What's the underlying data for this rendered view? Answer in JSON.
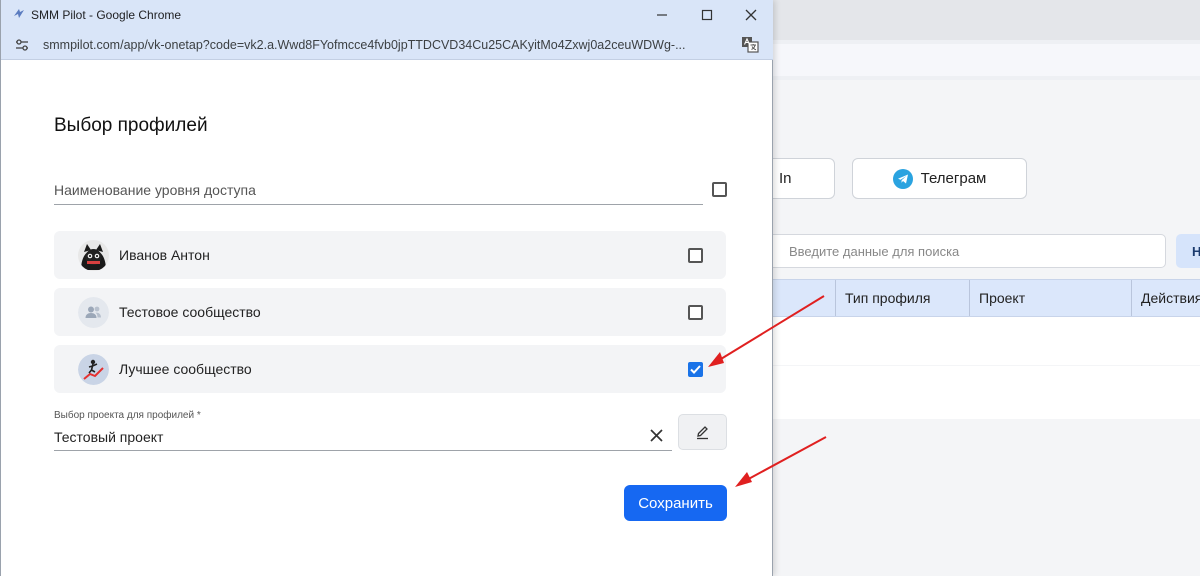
{
  "window": {
    "title": "SMM Pilot - Google Chrome",
    "url": "smmpilot.com/app/vk-onetap?code=vk2.a.Wwd8FYofmcce4fvb0jpTTDCVD34Cu25CAKyitMo4Zxwj0a2ceuWDWg-..."
  },
  "dialog": {
    "title": "Выбор профилей",
    "access_level_placeholder": "Наименование уровня доступа",
    "profiles": [
      {
        "name": "Иванов Антон",
        "checked": false
      },
      {
        "name": "Тестовое сообщество",
        "checked": false
      },
      {
        "name": "Лучшее сообщество",
        "checked": true
      }
    ],
    "project_label": "Выбор проекта для профилей *",
    "project_value": "Тестовый проект",
    "save_label": "Сохранить"
  },
  "background": {
    "button_in_label": "In",
    "button_telegram_label": "Телеграм",
    "search_placeholder": "Введите данные для поиска",
    "search_button_label": "Н",
    "table_headers": [
      "Тип профиля",
      "Проект",
      "Действия"
    ]
  },
  "colors": {
    "accent": "#1668f2",
    "annotation_arrow": "#e02020",
    "titlebar": "#d9e5f8"
  }
}
